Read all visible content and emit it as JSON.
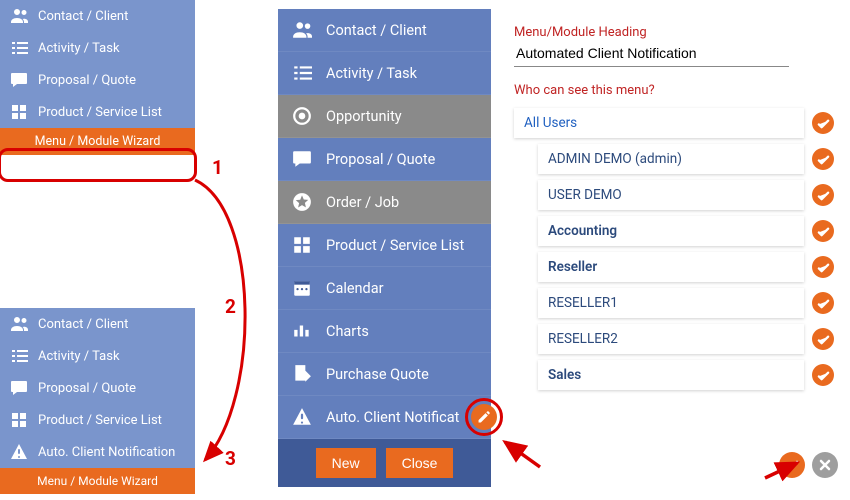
{
  "panelA": {
    "items": [
      {
        "icon": "people",
        "label": "Contact / Client"
      },
      {
        "icon": "list",
        "label": "Activity / Task"
      },
      {
        "icon": "chat",
        "label": "Proposal / Quote"
      },
      {
        "icon": "grid",
        "label": "Product / Service List"
      }
    ],
    "wizard_label": "Menu / Module Wizard"
  },
  "panelB": {
    "items": [
      {
        "icon": "people",
        "label": "Contact / Client"
      },
      {
        "icon": "list",
        "label": "Activity / Task"
      },
      {
        "icon": "chat",
        "label": "Proposal / Quote"
      },
      {
        "icon": "grid",
        "label": "Product / Service List"
      },
      {
        "icon": "alert",
        "label": "Auto. Client Notification"
      }
    ],
    "wizard_label": "Menu / Module Wizard"
  },
  "panelC": {
    "items": [
      {
        "icon": "people",
        "label": "Contact / Client",
        "gray": false
      },
      {
        "icon": "list",
        "label": "Activity / Task",
        "gray": false
      },
      {
        "icon": "target",
        "label": "Opportunity",
        "gray": true
      },
      {
        "icon": "chat",
        "label": "Proposal / Quote",
        "gray": false
      },
      {
        "icon": "star",
        "label": "Order / Job",
        "gray": true
      },
      {
        "icon": "grid",
        "label": "Product / Service List",
        "gray": false
      },
      {
        "icon": "calendar",
        "label": "Calendar",
        "gray": false
      },
      {
        "icon": "bars",
        "label": "Charts",
        "gray": false
      },
      {
        "icon": "export",
        "label": "Purchase Quote",
        "gray": false
      },
      {
        "icon": "alert",
        "label": "Auto. Client Notificat",
        "gray": false,
        "editable": true
      }
    ],
    "new_label": "New",
    "close_label": "Close"
  },
  "panelD": {
    "heading_label": "Menu/Module Heading",
    "heading_value": "Automated Client Notification",
    "who_label": "Who can see this menu?",
    "rows": [
      {
        "label": "All Users",
        "indent": 0,
        "sel": true,
        "bold": false
      },
      {
        "label": "ADMIN DEMO (admin)",
        "indent": 1,
        "sel": false,
        "bold": false
      },
      {
        "label": "USER DEMO",
        "indent": 1,
        "sel": false,
        "bold": false
      },
      {
        "label": "Accounting",
        "indent": 1,
        "sel": false,
        "bold": true
      },
      {
        "label": "Reseller",
        "indent": 1,
        "sel": false,
        "bold": true
      },
      {
        "label": "RESELLER1",
        "indent": 1,
        "sel": false,
        "bold": false
      },
      {
        "label": "RESELLER2",
        "indent": 1,
        "sel": false,
        "bold": false
      },
      {
        "label": "Sales",
        "indent": 1,
        "sel": false,
        "bold": true
      }
    ]
  },
  "callouts": {
    "one": "1",
    "two": "2",
    "three": "3"
  }
}
